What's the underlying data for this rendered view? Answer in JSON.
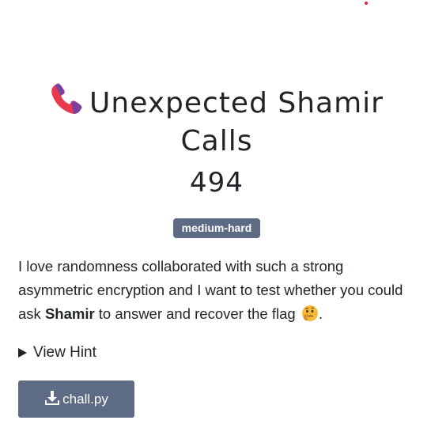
{
  "challenge": {
    "title": "Unexpected Shamir Calls",
    "title_icon": "telephone-receiver-icon",
    "points": "494",
    "difficulty": "medium-hard",
    "description": {
      "part1": "I love randomness collaborated with such a strong asymmetric encryption and I want to test whether you could ask ",
      "bold": "Shamir",
      "part2": " to answer and recover the flag ",
      "emoji": "thinking-face-icon",
      "part3": "."
    },
    "hint_label": "View Hint",
    "file": {
      "name": "chall.py",
      "icon": "download-icon"
    }
  },
  "colors": {
    "badge": "#5d6b85",
    "button": "#5d6b85",
    "text": "#212529",
    "phone_red": "#e83a4b",
    "phone_purple": "#7b3fa0"
  }
}
